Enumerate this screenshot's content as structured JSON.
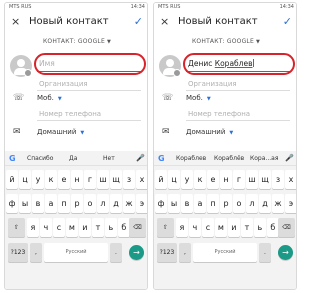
{
  "status_bar": {
    "carrier": "MTS RUS",
    "right_text": "14:34"
  },
  "header": {
    "close_icon": "×",
    "title": "Новый контакт",
    "save_icon": "✓"
  },
  "account": {
    "label": "КОНТАКТ: GOOGLE"
  },
  "fields": {
    "name_placeholder": "Имя",
    "organization_placeholder": "Организация",
    "phone_type": "Моб.",
    "phone_placeholder": "Номер телефона",
    "email_type": "Домашний"
  },
  "right_screen": {
    "name_first": "Денис",
    "name_last": "Кораблев"
  },
  "keyboard": {
    "left_suggestions": [
      "Спасибо",
      "Да",
      "Нет"
    ],
    "right_suggestions": [
      "Кораблев",
      "Кораблёв",
      "Кора...ая"
    ],
    "rows": [
      [
        "й",
        "ц",
        "у",
        "к",
        "е",
        "н",
        "г",
        "ш",
        "щ",
        "з",
        "х"
      ],
      [
        "ф",
        "ы",
        "в",
        "а",
        "п",
        "р",
        "о",
        "л",
        "д",
        "ж",
        "э"
      ],
      [
        "я",
        "ч",
        "с",
        "м",
        "и",
        "т",
        "ь",
        "б",
        "ю"
      ]
    ],
    "shift_icon": "⇧",
    "backspace_icon": "⌫",
    "numbers_label": "?123",
    "comma_label": ",",
    "space_label": "Русский",
    "period_label": ".",
    "enter_icon": "→"
  },
  "colors": {
    "accent": "#2a6fdb",
    "highlight": "#d8232a",
    "enter_key": "#1a9a87"
  }
}
